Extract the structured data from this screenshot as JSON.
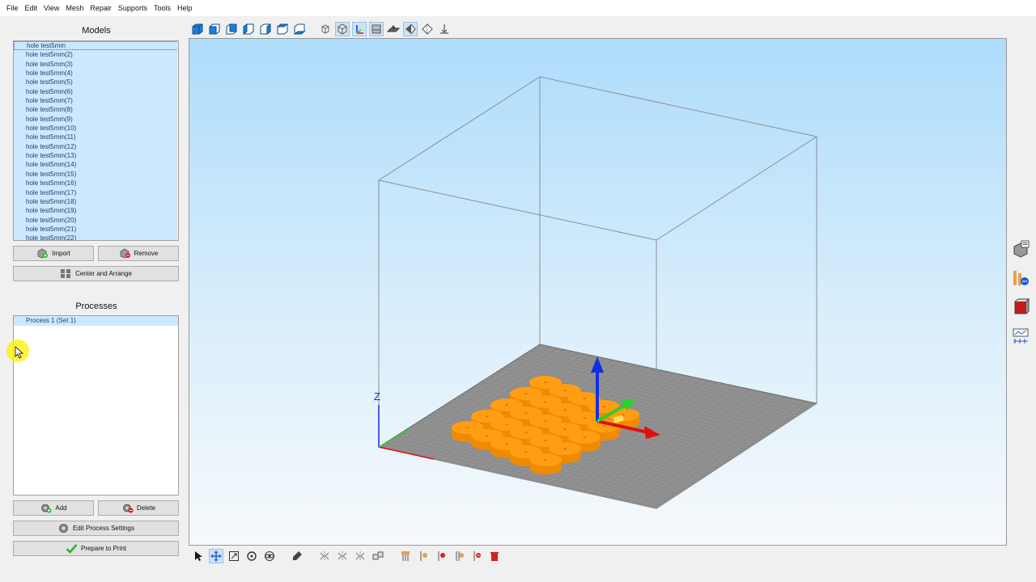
{
  "menubar": [
    "File",
    "Edit",
    "View",
    "Mesh",
    "Repair",
    "Supports",
    "Tools",
    "Help"
  ],
  "models": {
    "title": "Models",
    "items": [
      "hole test5mm",
      "hole test5mm(2)",
      "hole test5mm(3)",
      "hole test5mm(4)",
      "hole test5mm(5)",
      "hole test5mm(6)",
      "hole test5mm(7)",
      "hole test5mm(8)",
      "hole test5mm(9)",
      "hole test5mm(10)",
      "hole test5mm(11)",
      "hole test5mm(12)",
      "hole test5mm(13)",
      "hole test5mm(14)",
      "hole test5mm(15)",
      "hole test5mm(16)",
      "hole test5mm(17)",
      "hole test5mm(18)",
      "hole test5mm(19)",
      "hole test5mm(20)",
      "hole test5mm(21)",
      "hole test5mm(22)"
    ],
    "import_label": "Import",
    "remove_label": "Remove",
    "arrange_label": "Center and Arrange"
  },
  "processes": {
    "title": "Processes",
    "items": [
      "Process 1 (Set 1)"
    ],
    "add_label": "Add",
    "delete_label": "Delete",
    "edit_label": "Edit Process Settings",
    "prepare_label": "Prepare to Print"
  },
  "viewport": {
    "axis_label": "Z",
    "part_color": "#ff9e12",
    "bed_color": "#8c8c8c"
  },
  "colors": {
    "selection": "#cce8ff",
    "view_cube": "#1e7fd6",
    "axis_x": "#e01010",
    "axis_y": "#2bd02b",
    "axis_z": "#1030e0"
  }
}
